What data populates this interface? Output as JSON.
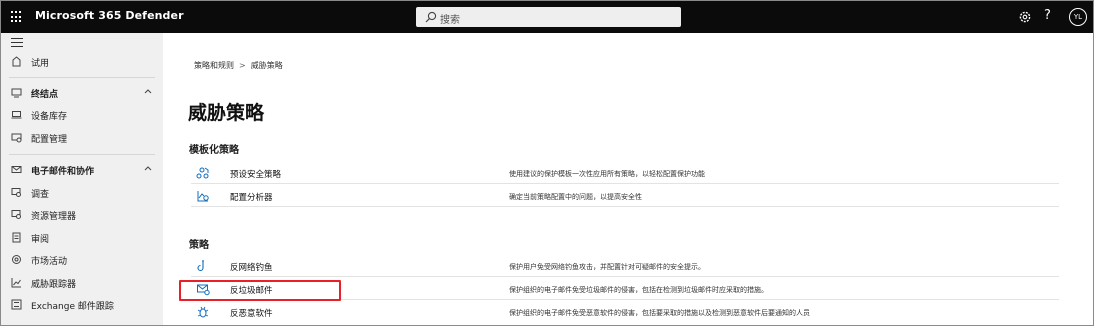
{
  "topbar": {
    "app_title": "Microsoft 365 Defender",
    "search_placeholder": "搜索",
    "avatar_initials": "YL",
    "help_glyph": "?"
  },
  "sidebar": {
    "items": [
      {
        "label": "试用",
        "icon": "trial-icon"
      },
      {
        "label": "终结点",
        "icon": "endpoint-icon",
        "section": true
      },
      {
        "label": "设备库存",
        "icon": "device-icon"
      },
      {
        "label": "配置管理",
        "icon": "config-icon"
      },
      {
        "label": "电子邮件和协作",
        "icon": "mail-icon",
        "section": true
      },
      {
        "label": "调查",
        "icon": "investigation-icon"
      },
      {
        "label": "资源管理器",
        "icon": "explorer-icon"
      },
      {
        "label": "审阅",
        "icon": "review-icon"
      },
      {
        "label": "市场活动",
        "icon": "campaign-icon"
      },
      {
        "label": "威胁跟踪器",
        "icon": "tracker-icon"
      },
      {
        "label": "Exchange 邮件跟踪",
        "icon": "exchange-icon"
      }
    ]
  },
  "main": {
    "breadcrumb": [
      "策略和规则",
      "威胁策略"
    ],
    "breadcrumb_sep": ">",
    "title": "威胁策略",
    "templated_heading": "模板化策略",
    "templated_rows": [
      {
        "name": "预设安全策略",
        "desc": "使用建议的保护模板一次性应用所有策略，以轻松配置保护功能",
        "icon": "preset-policy-icon"
      },
      {
        "name": "配置分析器",
        "desc": "确定当前策略配置中的问题，以提高安全性",
        "icon": "config-analyzer-icon"
      }
    ],
    "policies_heading": "策略",
    "policy_rows": [
      {
        "name": "反网络钓鱼",
        "desc": "保护用户免受网络钓鱼攻击，并配置针对可疑邮件的安全提示。",
        "icon": "anti-phishing-icon"
      },
      {
        "name": "反垃圾邮件",
        "desc": "保护组织的电子邮件免受垃圾邮件的侵害，包括在检测到垃圾邮件时应采取的措施。",
        "icon": "anti-spam-icon"
      },
      {
        "name": "反恶意软件",
        "desc": "保护组织的电子邮件免受恶意软件的侵害，包括要采取的措施以及检测到恶意软件后要通知的人员",
        "icon": "anti-malware-icon"
      }
    ]
  },
  "colors": {
    "topbar": "#0b0b0b",
    "sidebar": "#f0f0f0",
    "highlight": "#e8202a",
    "icon_blue": "#0f6cbd"
  }
}
